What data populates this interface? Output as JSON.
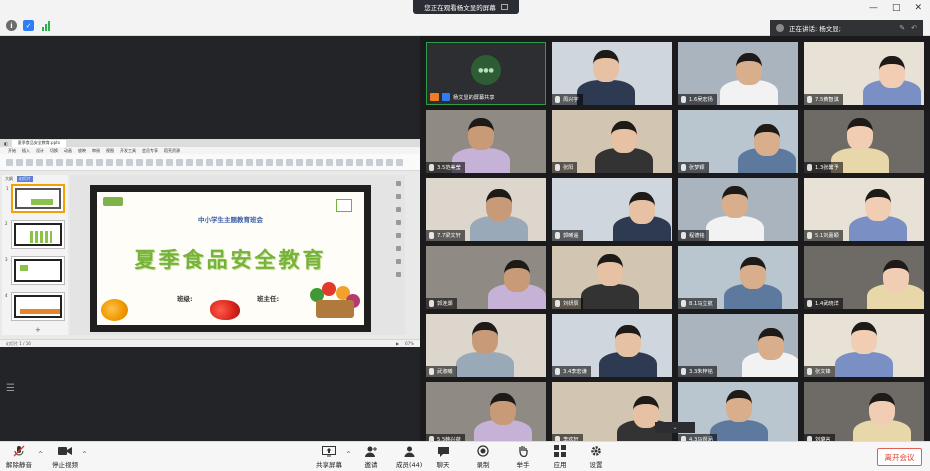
{
  "banner": {
    "text": "您正在观看杨文显的屏幕"
  },
  "speaking": {
    "text": "正在讲话: 杨文显;"
  },
  "host_tile": {
    "name": "杨文显的屏幕共享"
  },
  "participants": [
    "周兴宇",
    "1.6吴宏扬",
    "7.5黄智淇",
    "3.5范美莹",
    "张阳",
    "张梦颖",
    "1.3张馨予",
    "7.7梁文轩",
    "郭晞遥",
    "程德铭",
    "5.1刘嘉颖",
    "郭连灏",
    "刘妍辰",
    "8.1马立航",
    "1.4武晓洋",
    "武淑曦",
    "3.4李宏谦",
    "3.3朱梓铭",
    "张文锋",
    "5.5韩兴荷",
    "李欢轩",
    "4.3马煜涵",
    "刘璐言"
  ],
  "slide": {
    "subtitle": "中小学生主题教育班会",
    "title": "夏季食品安全教育",
    "field1": "班级:",
    "field2": "班主任:"
  },
  "ppt": {
    "tab_label": "夏季食品安全教育.pptx",
    "status_left": "幻灯片 1 / 16",
    "zoom": "67%",
    "thumb_tabs": [
      "大纲",
      "幻灯片"
    ],
    "menu": [
      "开始",
      "插入",
      "设计",
      "切换",
      "动画",
      "放映",
      "审阅",
      "视图",
      "开发工具",
      "会员专享",
      "稻壳资源"
    ]
  },
  "toolbar": {
    "mute": "解除静音",
    "video": "停止视频",
    "share": "共享屏幕",
    "invite": "邀请",
    "members": "成员(44)",
    "chat": "聊天",
    "record": "录制",
    "raise_hand": "举手",
    "apps": "应用",
    "settings": "设置",
    "leave": "离开会议"
  },
  "colors": {
    "accent_green": "#2f9c4a",
    "leave_red": "#e03b2f",
    "slide_title_green": "#77b23a"
  }
}
